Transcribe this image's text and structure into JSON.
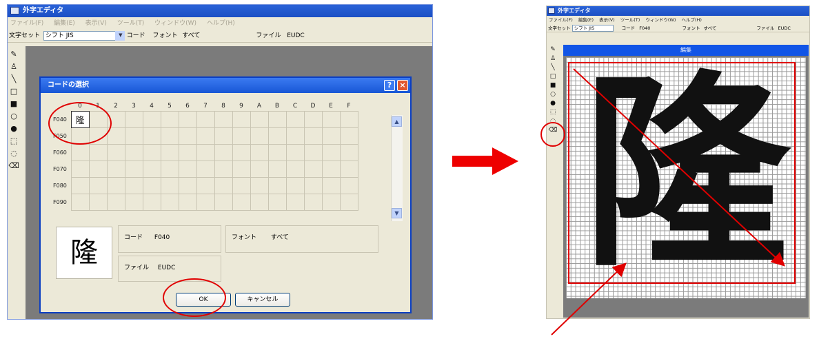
{
  "left_window": {
    "title": "外字エディタ",
    "menu": [
      "ファイル(F)",
      "編集(E)",
      "表示(V)",
      "ツール(T)",
      "ウィンドウ(W)",
      "ヘルプ(H)"
    ],
    "charset_label": "文字セット",
    "charset_value": "シフト JIS",
    "code_label": "コード",
    "font_label": "フォント",
    "font_value": "すべて",
    "file_label": "ファイル",
    "file_value": "EUDC"
  },
  "dialog": {
    "title": "コードの選択",
    "help_button": "?",
    "close_button": "×",
    "column_headers": [
      "0",
      "1",
      "2",
      "3",
      "4",
      "5",
      "6",
      "7",
      "8",
      "9",
      "A",
      "B",
      "C",
      "D",
      "E",
      "F"
    ],
    "rows": [
      {
        "label": "F040",
        "first_cell": "隆"
      },
      {
        "label": "F050",
        "first_cell": ""
      },
      {
        "label": "F060",
        "first_cell": ""
      },
      {
        "label": "F070",
        "first_cell": ""
      },
      {
        "label": "F080",
        "first_cell": ""
      },
      {
        "label": "F090",
        "first_cell": ""
      }
    ],
    "preview_char": "隆",
    "code_label": "コード",
    "code_value": "F040",
    "font_label": "フォント",
    "font_value": "すべて",
    "file_label": "ファイル",
    "file_value": "EUDC",
    "ok_label": "OK",
    "cancel_label": "キャンセル",
    "scroll_up": "▲",
    "scroll_down": "▼"
  },
  "right_window": {
    "title": "外字エディタ",
    "menu": [
      "ファイル(F)",
      "編集(E)",
      "表示(V)",
      "ツール(T)",
      "ウィンドウ(W)",
      "ヘルプ(H)"
    ],
    "charset_label": "文字セット",
    "charset_value": "シフト JIS",
    "code_label": "コード",
    "code_value": "F040",
    "font_label": "フォント",
    "font_value": "すべて",
    "file_label": "ファイル",
    "file_value": "EUDC",
    "edit_band": "編集",
    "glyph": "隆"
  },
  "colors": {
    "annotation_red": "#e00000",
    "title_blue": "#1b4fc4"
  },
  "icons": {
    "flow_arrow": "arrow-right-icon",
    "tools": [
      "pencil-icon",
      "brush-icon",
      "line-icon",
      "rect-outline-icon",
      "rect-fill-icon",
      "ellipse-outline-icon",
      "ellipse-fill-icon",
      "rect-select-icon",
      "freeform-select-icon",
      "eraser-icon"
    ]
  }
}
